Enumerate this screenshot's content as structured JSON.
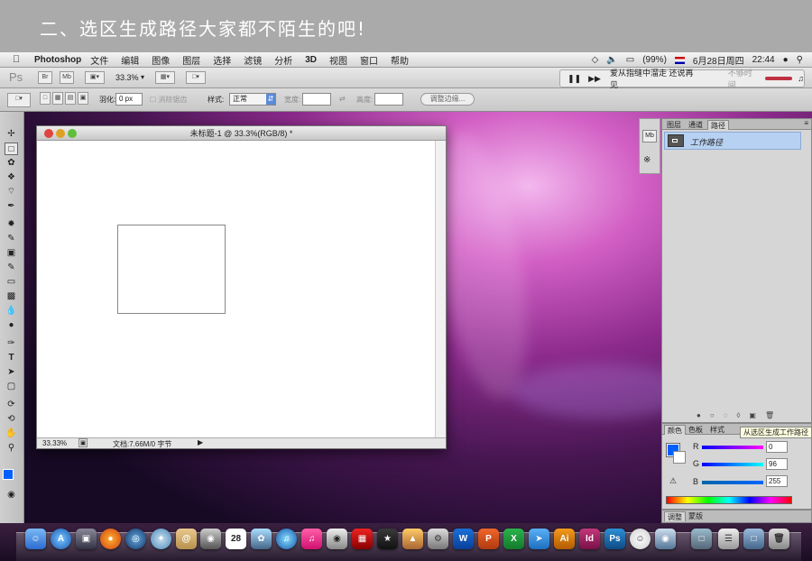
{
  "banner": {
    "title": "二、选区生成路径大家都不陌生的吧!"
  },
  "menubar": {
    "apple": "",
    "app": "Photoshop",
    "items": [
      "文件",
      "编辑",
      "图像",
      "图层",
      "选择",
      "滤镜",
      "分析",
      "3D",
      "视图",
      "窗口",
      "帮助"
    ],
    "status": {
      "battery": "(99%)",
      "date": "6月28日周四",
      "time": "22:44"
    }
  },
  "psbar": {
    "logo": "Ps",
    "br": "Br",
    "mb": "Mb",
    "zoom": "33.3%"
  },
  "media": {
    "track": "爱从指缝中溜走 还说再见",
    "right": "不够时间"
  },
  "options": {
    "feather_label": "羽化:",
    "feather_value": "0 px",
    "antialias": "消除锯齿",
    "style_label": "样式:",
    "style_value": "正常",
    "width_label": "宽度:",
    "height_label": "高度:",
    "refine": "调整边缘..."
  },
  "document": {
    "title": "未标题-1 @ 33.3%(RGB/8) *",
    "zoom": "33.33%",
    "info": "文档:7.66M/0 字节"
  },
  "panel": {
    "tabs": [
      "图层",
      "通道",
      "路径"
    ],
    "path_item": "工作路径",
    "mb": "Mb"
  },
  "tooltip": "从选区生成工作路径",
  "color": {
    "tabs": [
      "颜色",
      "色板",
      "样式"
    ],
    "r_label": "R",
    "r": "0",
    "g_label": "G",
    "g": "96",
    "b_label": "B",
    "b": "255"
  },
  "adjust": {
    "tabs": [
      "调整",
      "蒙版"
    ]
  },
  "colors": {
    "foreground": "#0060ff",
    "accent": "#b7d1f2"
  },
  "dock": {
    "calendar_day": "28"
  }
}
